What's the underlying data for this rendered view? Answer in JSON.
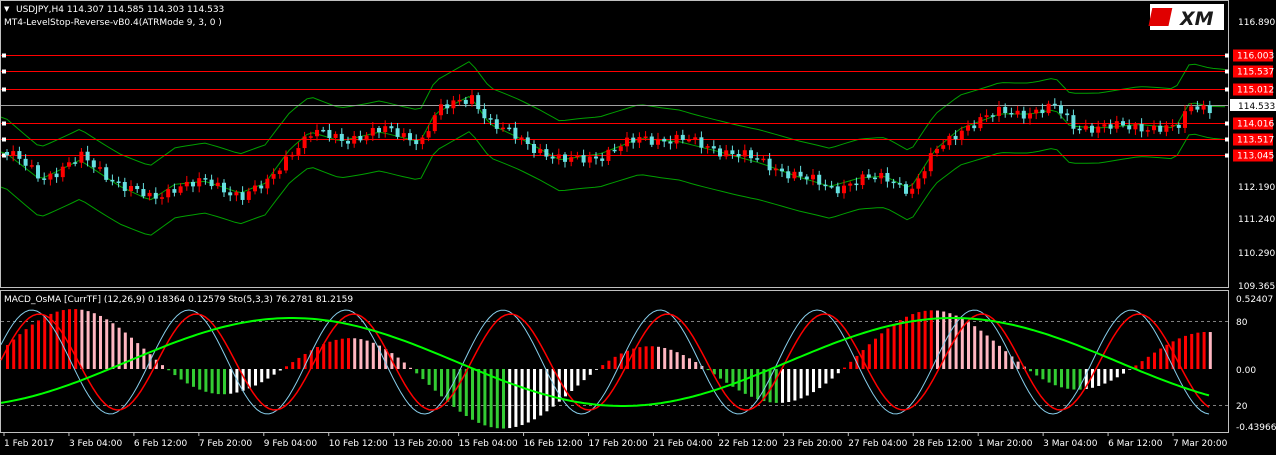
{
  "header": {
    "symbol_line": "USDJPY,H4  114.307 114.585 114.303 114.533",
    "indicator_line": "MT4-LevelStop-Reverse-vB0.4(ATRMode 9, 3, 0 )"
  },
  "brand": {
    "logo_text": "XM"
  },
  "price_axis": {
    "ticks": [
      "116.890",
      "114.533",
      "112.190",
      "111.240",
      "110.290",
      "109.365"
    ],
    "current": "114.533"
  },
  "levels": [
    {
      "label": "116.003",
      "price": 116.003
    },
    {
      "label": "115.537",
      "price": 115.537
    },
    {
      "label": "115.012",
      "price": 115.012
    },
    {
      "label": "114.016",
      "price": 114.016
    },
    {
      "label": "113.517",
      "price": 113.517
    },
    {
      "label": "113.045",
      "price": 113.045
    }
  ],
  "sub_panel": {
    "title": "MACD_OsMA [CurrTF] (12,26,9) 0.18364 0.12579  Sto(5,3,3) 76.2781 81.2159",
    "ticks": [
      "0.52407",
      "80",
      "0.00",
      "20",
      "-0.43966"
    ]
  },
  "time_axis": {
    "labels": [
      "1 Feb 2017",
      "3 Feb 04:00",
      "6 Feb 12:00",
      "7 Feb 20:00",
      "9 Feb 04:00",
      "10 Feb 12:00",
      "13 Feb 20:00",
      "15 Feb 04:00",
      "16 Feb 12:00",
      "17 Feb 20:00",
      "21 Feb 04:00",
      "22 Feb 12:00",
      "23 Feb 20:00",
      "27 Feb 04:00",
      "28 Feb 12:00",
      "1 Mar 20:00",
      "3 Mar 04:00",
      "6 Mar 12:00",
      "7 Mar 20:00"
    ]
  },
  "colors": {
    "bull": "#ff0000",
    "bear": "#66e0e0",
    "band": "#00a000",
    "level_line": "#ff0000",
    "stoch_main": "#87ceeb",
    "stoch_signal": "#ff0000",
    "macd_line": "#00ff00",
    "hist_up_strong": "#ff0000",
    "hist_up_weak": "#ffb6c1",
    "hist_down_strong": "#33cc33",
    "hist_down_weak": "#ffffff"
  }
}
